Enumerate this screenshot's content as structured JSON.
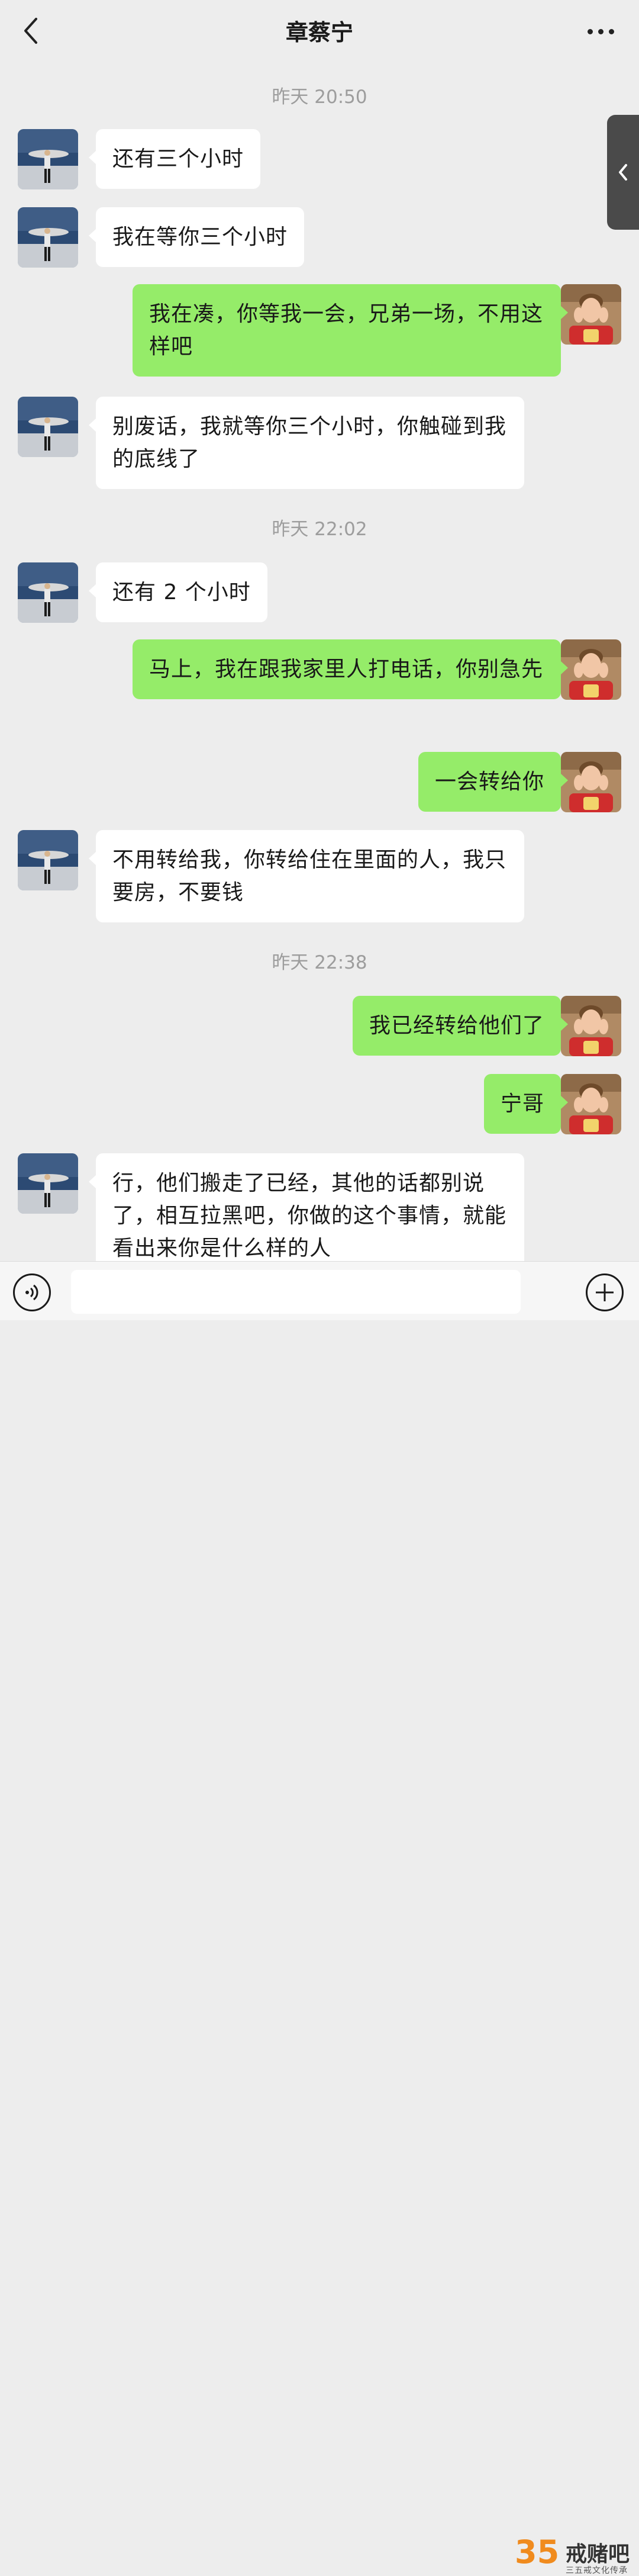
{
  "header": {
    "title": "章蔡宁",
    "back_icon": "chevron-left-icon",
    "more_icon": "more-dots-icon"
  },
  "timestamps": [
    "昨天 20:50",
    "昨天 22:02",
    "昨天 22:38"
  ],
  "messages": [
    {
      "side": "in",
      "text": "还有三个小时"
    },
    {
      "side": "in",
      "text": "我在等你三个小时"
    },
    {
      "side": "out",
      "text": "我在凑，你等我一会，兄弟一场，不用这样吧"
    },
    {
      "side": "in",
      "text": "别废话，我就等你三个小时，你触碰到我的底线了"
    },
    {
      "side": "in",
      "text": "还有 2 个小时"
    },
    {
      "side": "out",
      "text": "马上，我在跟我家里人打电话，你别急先"
    },
    {
      "side": "out",
      "text": "一会转给你"
    },
    {
      "side": "in",
      "text": "不用转给我，你转给住在里面的人，我只要房，不要钱"
    },
    {
      "side": "out",
      "text": "我已经转给他们了"
    },
    {
      "side": "out",
      "text": "宁哥"
    },
    {
      "side": "in",
      "text": "行，他们搬走了已经，其他的话都别说了，相互拉黑吧，你做的这个事情，就能看出来你是什么样的人"
    }
  ],
  "input_bar": {
    "voice_icon": "voice-icon",
    "plus_icon": "plus-icon",
    "text_value": ""
  },
  "watermark": {
    "number": "35",
    "title": "戒赌吧",
    "subtitle": "三五戒文化传承"
  },
  "colors": {
    "background": "#ededed",
    "outgoing_bubble": "#95ec69",
    "incoming_bubble": "#ffffff",
    "timestamp": "#9d9d9d"
  }
}
